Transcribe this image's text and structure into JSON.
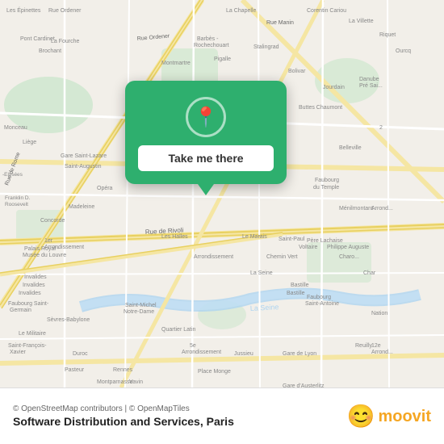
{
  "map": {
    "callout": {
      "button_label": "Take me there"
    },
    "attribution": "© OpenStreetMap contributors | © OpenMapTiles",
    "location_title": "Software Distribution and Services, Paris"
  },
  "branding": {
    "moovit_label": "moovit"
  },
  "colors": {
    "green": "#2eaf6e",
    "orange": "#f5a623",
    "white": "#ffffff"
  },
  "icons": {
    "pin": "📍",
    "moovit_face": "😊"
  }
}
